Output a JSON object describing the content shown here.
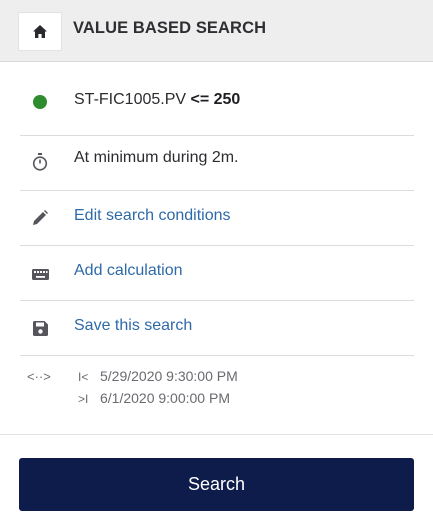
{
  "header": {
    "title": "VALUE BASED SEARCH",
    "home_icon": "home-icon"
  },
  "condition": {
    "status_color": "#2e8b2e",
    "tag": "ST-FIC1005.PV",
    "operator": "<= 250"
  },
  "duration": {
    "icon": "stopwatch-icon",
    "text": "At minimum during 2m."
  },
  "actions": {
    "edit_label": "Edit search conditions",
    "edit_icon": "pencil-icon",
    "calc_label": "Add calculation",
    "calc_icon": "keyboard-icon",
    "save_label": "Save this search",
    "save_icon": "floppy-disk-icon"
  },
  "time_range": {
    "icon_text": "<··>",
    "start_marker": "I<",
    "start": "5/29/2020 9:30:00 PM",
    "end_marker": ">I",
    "end": "6/1/2020 9:00:00 PM"
  },
  "search_button": {
    "label": "Search",
    "color": "#0d1c4a"
  },
  "link_color": "#2e6aa8"
}
